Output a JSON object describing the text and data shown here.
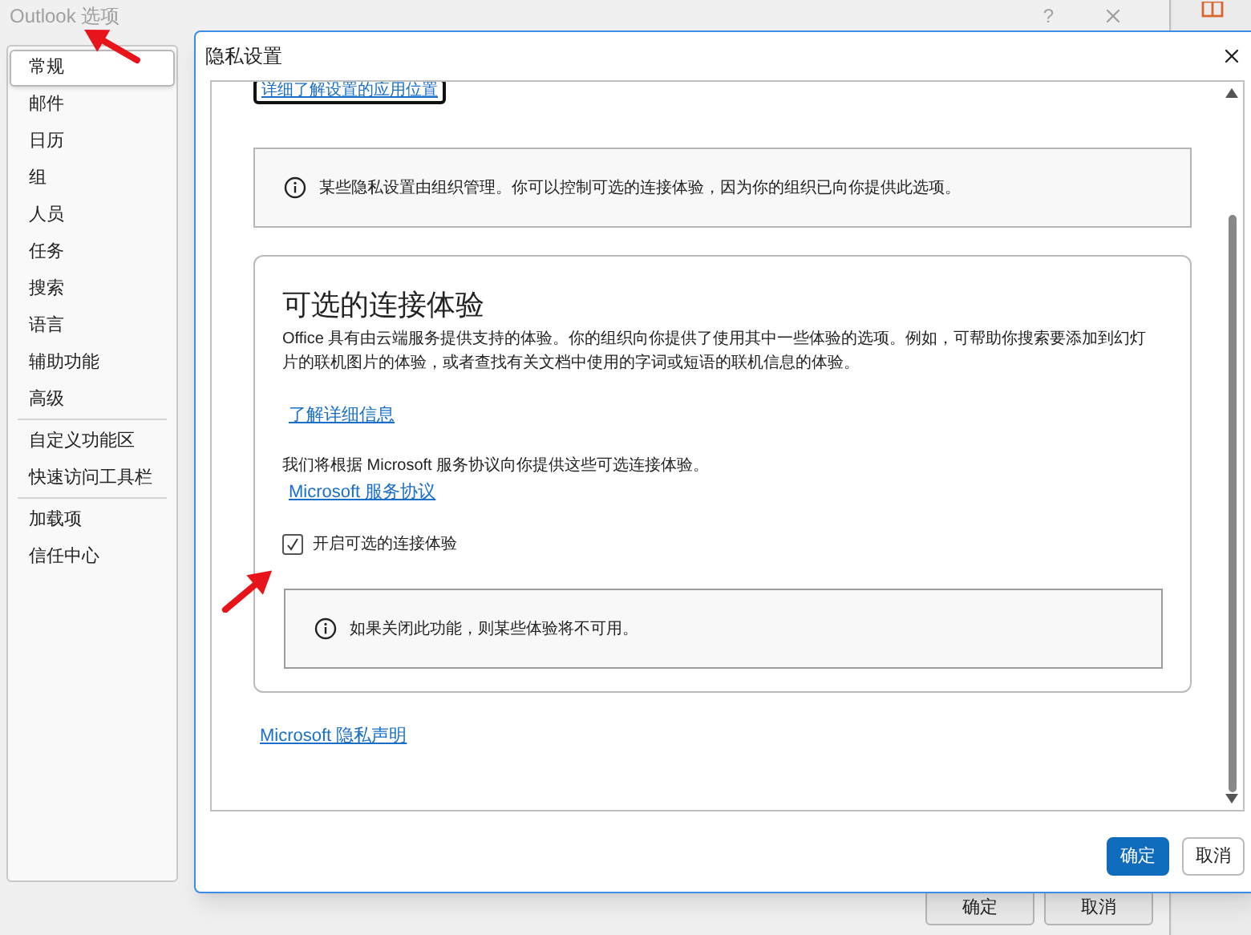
{
  "options_window": {
    "title": "Outlook 选项",
    "help": "?",
    "nav_groups": [
      [
        {
          "label": "常规",
          "selected": true
        },
        {
          "label": "邮件",
          "selected": false
        },
        {
          "label": "日历",
          "selected": false
        },
        {
          "label": "组",
          "selected": false
        },
        {
          "label": "人员",
          "selected": false
        },
        {
          "label": "任务",
          "selected": false
        },
        {
          "label": "搜索",
          "selected": false
        },
        {
          "label": "语言",
          "selected": false
        },
        {
          "label": "辅助功能",
          "selected": false
        },
        {
          "label": "高级",
          "selected": false
        }
      ],
      [
        {
          "label": "自定义功能区",
          "selected": false
        },
        {
          "label": "快速访问工具栏",
          "selected": false
        }
      ],
      [
        {
          "label": "加载项",
          "selected": false
        },
        {
          "label": "信任中心",
          "selected": false
        }
      ]
    ],
    "buttons": [
      "确定",
      "取消"
    ]
  },
  "dialog": {
    "title": "隐私设置",
    "top_link": "详细了解设置的应用位置",
    "notice": "某些隐私设置由组织管理。你可以控制可选的连接体验，因为你的组织已向你提供此选项。",
    "section": {
      "heading": "可选的连接体验",
      "description": "Office 具有由云端服务提供支持的体验。你的组织向你提供了使用其中一些体验的选项。例如，可帮助你搜索要添加到幻灯片的联机图片的体验，或者查找有关文档中使用的字词或短语的联机信息的体验。",
      "learn_more": "了解详细信息",
      "agreement_text": "我们将根据 Microsoft 服务协议向你提供这些可选连接体验。",
      "agreement_link": "Microsoft 服务协议",
      "checkbox": {
        "label": "开启可选的连接体验",
        "checked": true
      },
      "warning": "如果关闭此功能，则某些体验将不可用。"
    },
    "privacy_link": "Microsoft 隐私声明",
    "buttons": [
      {
        "label": "确定",
        "kind": "primary"
      },
      {
        "label": "取消",
        "kind": "secondary"
      }
    ]
  }
}
